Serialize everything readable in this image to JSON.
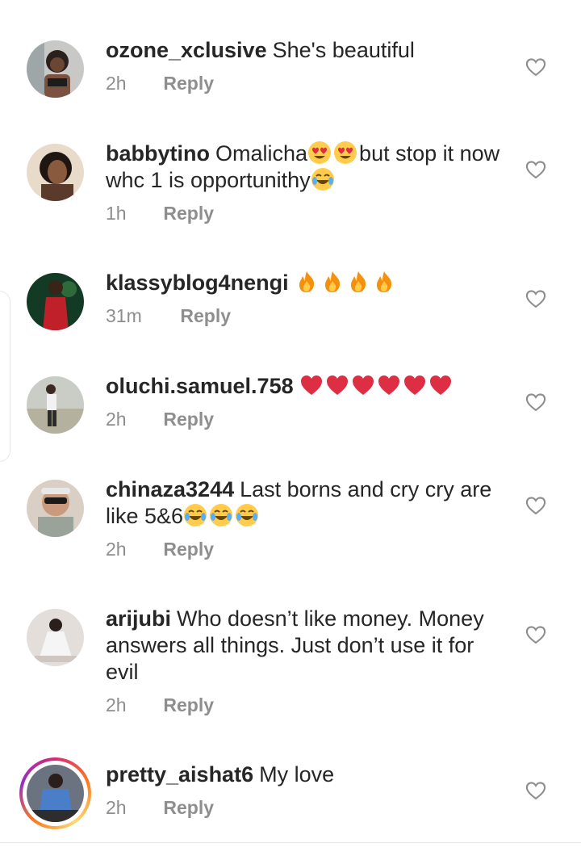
{
  "comments": [
    {
      "username": "ozone_xclusive",
      "text": "She's beautiful",
      "time": "2h",
      "reply": "Reply",
      "avatar": "avatar-woman-black-top",
      "avatar_color": "#6b5a4e"
    },
    {
      "username": "babbytino",
      "text_before": "Omalicha",
      "emoji": [
        "heart-eyes-emoji",
        "heart-eyes-emoji"
      ],
      "text_after": "but stop it now whc 1 is opportunithy",
      "emoji_end": "joy-emoji",
      "time": "1h",
      "reply": "Reply",
      "avatar": "avatar-woman-dark",
      "avatar_color": "#3a2a22"
    },
    {
      "username": "klassyblog4nengi",
      "emoji": [
        "fire-emoji",
        "fire-emoji",
        "fire-emoji",
        "fire-emoji"
      ],
      "time": "31m",
      "reply": "Reply",
      "avatar": "avatar-woman-red-dress",
      "avatar_color": "#123a25"
    },
    {
      "username": "oluchi.samuel.758",
      "emoji": [
        "red-heart-emoji",
        "red-heart-emoji",
        "red-heart-emoji",
        "red-heart-emoji",
        "red-heart-emoji",
        "red-heart-emoji"
      ],
      "time": "2h",
      "reply": "Reply",
      "avatar": "avatar-person-beach",
      "avatar_color": "#b9bfb5"
    },
    {
      "username": "chinaza3244",
      "text": "Last borns and cry cry are like 5&6",
      "emoji_end_multi": [
        "joy-emoji",
        "joy-emoji",
        "joy-emoji"
      ],
      "time": "2h",
      "reply": "Reply",
      "avatar": "avatar-person-sunglasses",
      "avatar_color": "#c9b7a8"
    },
    {
      "username": "arijubi",
      "text": "Who doesn’t like money. Money answers all things. Just don’t use it for evil",
      "time": "2h",
      "reply": "Reply",
      "avatar": "avatar-woman-white-dress",
      "avatar_color": "#d8d2cf"
    },
    {
      "username": "pretty_aishat6",
      "text": "My love",
      "time": "2h",
      "reply": "Reply",
      "avatar": "avatar-woman-blue-outfit",
      "avatar_color": "#4b5563"
    }
  ],
  "colors": {
    "username": "#262626",
    "text": "#262626",
    "meta": "#8e8e8e",
    "heart_outline": "#8e8e8e"
  },
  "icons": {
    "like": "heart-outline-icon"
  }
}
